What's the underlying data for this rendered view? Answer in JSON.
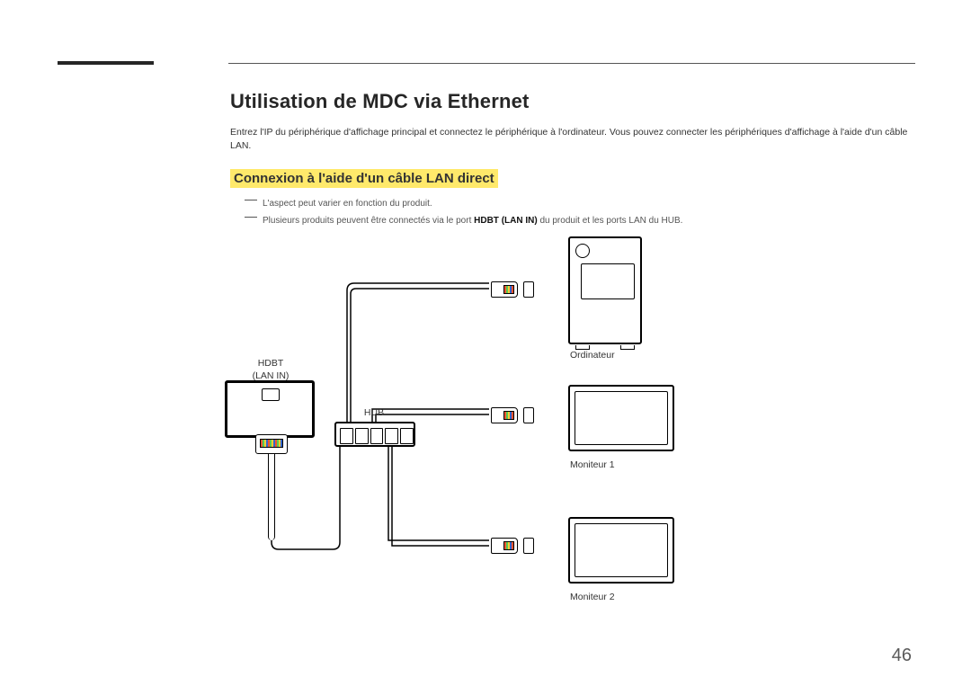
{
  "page_number": "46",
  "title": "Utilisation de MDC via Ethernet",
  "intro": "Entrez l'IP du périphérique d'affichage principal et connectez le périphérique à l'ordinateur. Vous pouvez connecter les périphériques d'affichage à l'aide d'un câble LAN.",
  "subtitle": "Connexion à l'aide d'un câble LAN direct",
  "notes": {
    "n1": "L'aspect peut varier en fonction du produit.",
    "n2_pre": "Plusieurs produits peuvent être connectés via le port ",
    "n2_strong": "HDBT (LAN IN)",
    "n2_post": " du produit et les ports LAN du HUB."
  },
  "diagram": {
    "hdbt_label_line1": "HDBT",
    "hdbt_label_line2": "(LAN IN)",
    "hub_label": "HUB",
    "computer_label": "Ordinateur",
    "monitor1_label": "Moniteur 1",
    "monitor2_label": "Moniteur 2"
  }
}
